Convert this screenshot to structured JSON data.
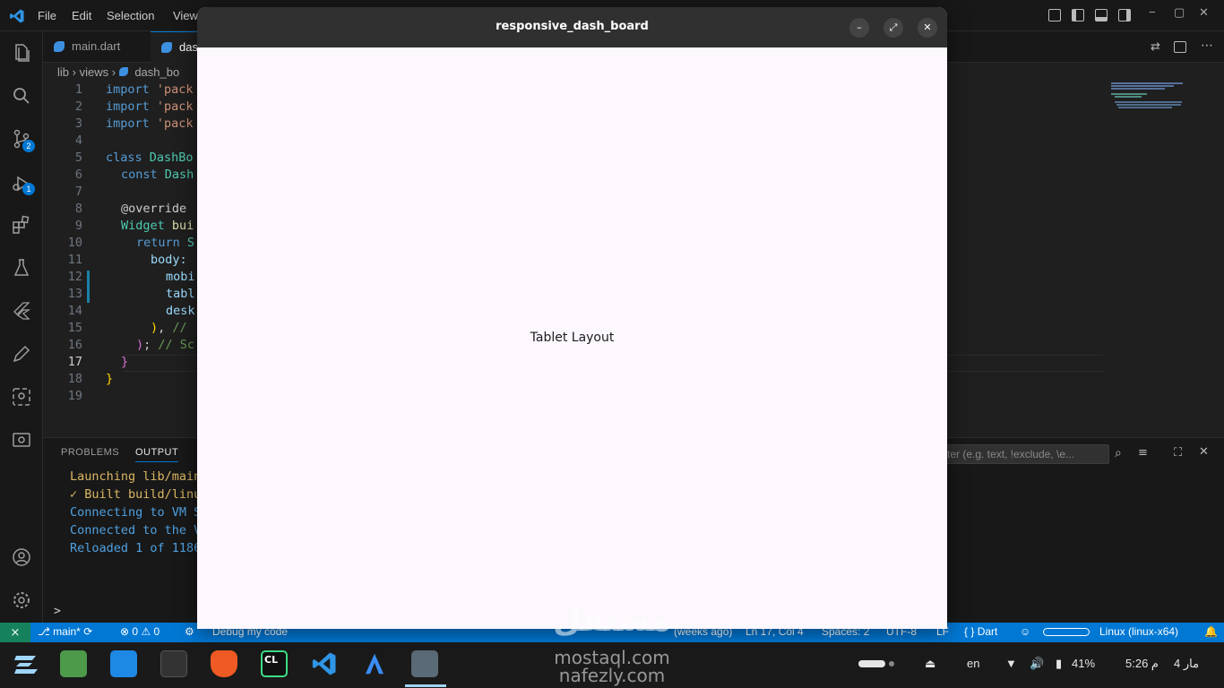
{
  "menu": {
    "file": "File",
    "edit": "Edit",
    "selection": "Selection",
    "view": "View"
  },
  "tabs": [
    {
      "label": "main.dart"
    },
    {
      "label": "dash"
    }
  ],
  "breadcrumb": {
    "lib": "lib",
    "views": "views",
    "file": "dash_bo"
  },
  "activity_badges": {
    "scm": "2",
    "debug": "1"
  },
  "editor": {
    "line_numbers": [
      "1",
      "2",
      "3",
      "4",
      "5",
      "6",
      "7",
      "8",
      "9",
      "10",
      "11",
      "12",
      "13",
      "14",
      "15",
      "16",
      "17",
      "18",
      "19"
    ],
    "current_line": "17",
    "l1_kw": "import",
    "l1_str": "'pack",
    "l2_kw": "import",
    "l2_str": "'pack",
    "l3_kw": "import",
    "l3_str": "'pack",
    "l5_kw": "class",
    "l5_cls": "DashBo",
    "l6_kw": "const",
    "l6_cls": "Dash",
    "l8": "@override",
    "l9_cls": "Widget",
    "l9_fn": "bui",
    "l10_kw": "return",
    "l10_cls": "S",
    "l11": "body:",
    "l12": "mobi",
    "l13": "tabl",
    "l14": "desk",
    "l15_br": ")",
    "l15_punct": ",",
    "l15_cm": "//",
    "l16_br": ")",
    "l16_punct": ";",
    "l16_cm": "// Sc",
    "l17": "}",
    "l18": "}"
  },
  "panel": {
    "tab_problems": "PROBLEMS",
    "tab_output": "OUTPUT",
    "filter_placeholder": "ter (e.g. text, !exclude, \\e...",
    "lines": [
      "Launching lib/main",
      "✓ Built build/linu",
      "Connecting to VM S",
      "Connected to the V",
      "Reloaded 1 of 1186"
    ],
    "prompt": ">"
  },
  "statusbar": {
    "branch": "main*",
    "errors": "0",
    "warnings": "0",
    "debug": "Debug my code",
    "blame": "(weeks ago)",
    "position": "Ln 17, Col 4",
    "spaces": "Spaces: 2",
    "encoding": "UTF-8",
    "eol": "LF",
    "language": "Dart",
    "device": "Linux (linux-x64)"
  },
  "app_window": {
    "title": "responsive_dash_board",
    "body_text": "Tablet Layout"
  },
  "taskbar": {
    "lang": "en",
    "battery": "41%",
    "time": "5:26 م",
    "date": "مار 4"
  },
  "watermark": {
    "line1": "مستقل",
    "line2": "mostaql.com",
    "line3": "nafezly.com"
  },
  "colors": {
    "accent": "#0078d4",
    "app_bg": "#fdf7fe",
    "app_header": "#303030"
  }
}
